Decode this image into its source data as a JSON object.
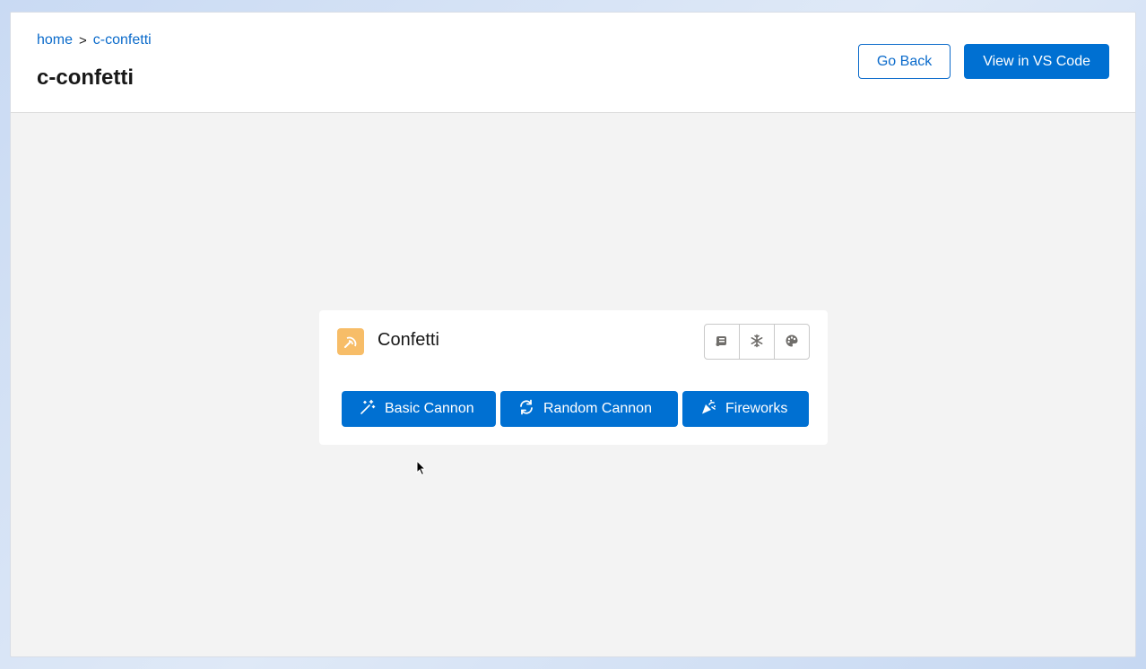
{
  "breadcrumb": {
    "home": "home",
    "separator": ">",
    "current": "c-confetti"
  },
  "page": {
    "title": "c-confetti"
  },
  "header_actions": {
    "go_back": "Go Back",
    "view_vscode": "View in VS Code"
  },
  "card": {
    "title": "Confetti",
    "header_icon": "confetti-icon",
    "icon_buttons": [
      "scroll-icon",
      "snowflake-icon",
      "palette-icon"
    ],
    "actions": [
      {
        "label": "Basic Cannon",
        "icon": "magic-wand-icon"
      },
      {
        "label": "Random Cannon",
        "icon": "refresh-icon"
      },
      {
        "label": "Fireworks",
        "icon": "party-popper-icon"
      }
    ]
  },
  "colors": {
    "brand": "#0070d2",
    "link": "#0b6bcb",
    "card_icon_bg": "#f7bd68",
    "canvas_bg": "#f3f3f3"
  }
}
